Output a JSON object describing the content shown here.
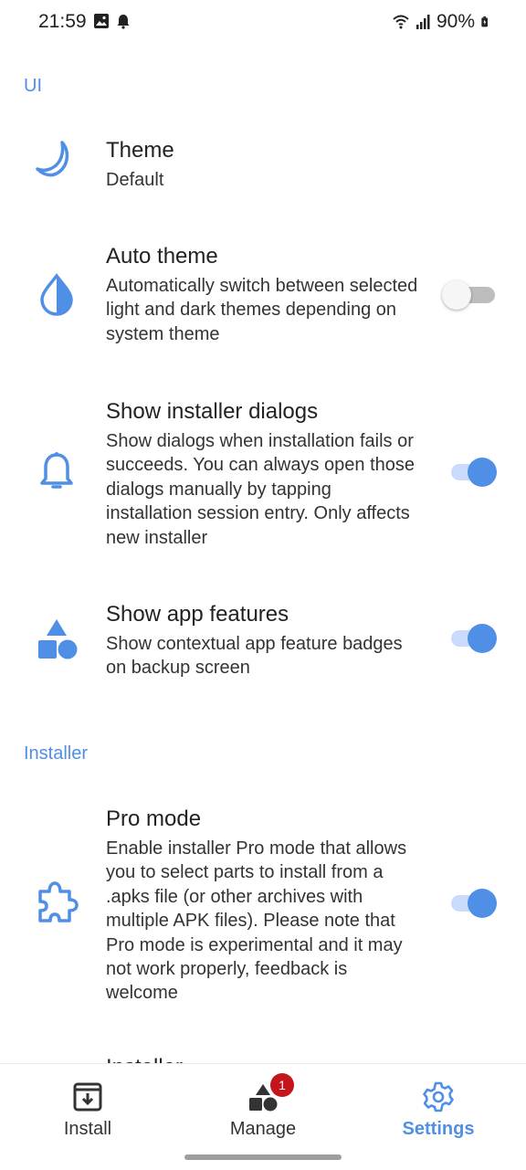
{
  "status_bar": {
    "time": "21:59",
    "battery": "90%",
    "icons": [
      "image-icon",
      "alarm-icon",
      "wifi-icon",
      "signal-icon",
      "battery-icon"
    ]
  },
  "sections": {
    "ui": "UI",
    "installer": "Installer"
  },
  "items": {
    "theme": {
      "title": "Theme",
      "desc": "Default"
    },
    "auto_theme": {
      "title": "Auto theme",
      "desc": "Automatically switch between selected light and dark themes depending on system theme",
      "enabled": false
    },
    "installer_dialogs": {
      "title": "Show installer dialogs",
      "desc": "Show dialogs when installation fails or succeeds. You can always open those dialogs manually by tapping installation session entry. Only affects new installer",
      "enabled": true
    },
    "app_features": {
      "title": "Show app features",
      "desc": "Show contextual app feature badges on backup screen",
      "enabled": true
    },
    "pro_mode": {
      "title": "Pro mode",
      "desc": "Enable installer Pro mode that allows you to select parts to install from a .apks file (or other archives with multiple APK files). Please note that Pro mode is experimental and it may not work properly, feedback is welcome",
      "enabled": true
    },
    "partial": {
      "title": "Installer"
    }
  },
  "nav": {
    "install": "Install",
    "manage": "Manage",
    "manage_badge": "1",
    "settings": "Settings"
  },
  "colors": {
    "accent": "#4f8fe6",
    "badge": "#c4141c"
  }
}
